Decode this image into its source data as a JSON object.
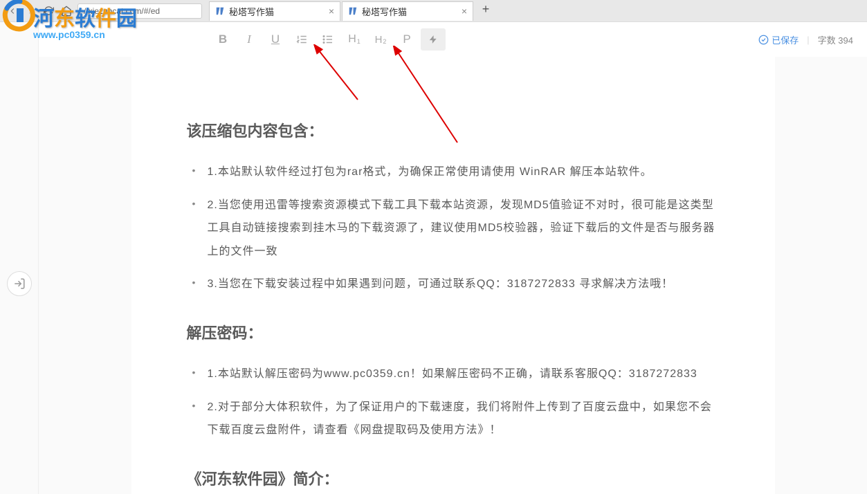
{
  "browser": {
    "url": "//xiezuocat.com/#/ed",
    "tabs": [
      {
        "title": "秘塔写作猫",
        "active": true
      },
      {
        "title": "秘塔写作猫",
        "active": false
      }
    ]
  },
  "watermark": {
    "brand": "河东软件园",
    "url": "www.pc0359.cn"
  },
  "toolbar": {
    "bold": "B",
    "italic": "I",
    "underline": "U",
    "ol": "≡",
    "ul": "≡",
    "h1": "H",
    "h1_sub": "1",
    "h2": "H",
    "h2_sub": "2",
    "p": "P",
    "bolt": "⚡"
  },
  "status": {
    "saved_label": "已保存",
    "word_count_label": "字数 394"
  },
  "doc": {
    "h1": "该压缩包内容包含：",
    "list1": [
      "1.本站默认软件经过打包为rar格式，为确保正常使用请使用 WinRAR 解压本站软件。",
      "2.当您使用迅雷等搜索资源模式下载工具下载本站资源，发现MD5值验证不对时，很可能是这类型工具自动链接搜索到挂木马的下载资源了，建议使用MD5校验器，验证下载后的文件是否与服务器上的文件一致",
      "3.当您在下载安装过程中如果遇到问题，可通过联系QQ：3187272833 寻求解决方法哦！"
    ],
    "h2": "解压密码：",
    "list2": [
      "1.本站默认解压密码为www.pc0359.cn！如果解压密码不正确，请联系客服QQ：3187272833",
      "2.对于部分大体积软件，为了保证用户的下载速度，我们将附件上传到了百度云盘中，如果您不会下载百度云盘附件，请查看《网盘提取码及使用方法》！"
    ],
    "h3": "《河东软件园》简介："
  }
}
